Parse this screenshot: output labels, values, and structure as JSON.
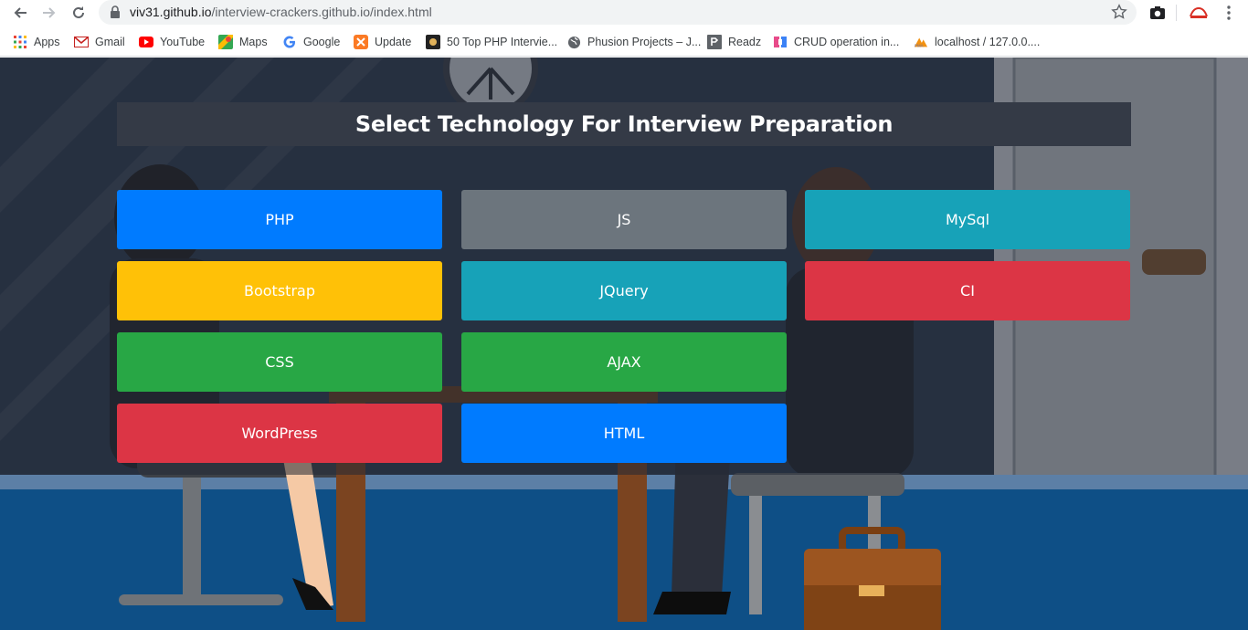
{
  "browser": {
    "url_host": "viv31.github.io",
    "url_path": "/interview-crackers.github.io/index.html",
    "bookmarks": [
      {
        "label": "Apps",
        "icon": "apps-grid-icon"
      },
      {
        "label": "Gmail",
        "icon": "gmail-icon"
      },
      {
        "label": "YouTube",
        "icon": "youtube-icon"
      },
      {
        "label": "Maps",
        "icon": "maps-icon"
      },
      {
        "label": "Google",
        "icon": "google-icon"
      },
      {
        "label": "Update",
        "icon": "xampp-icon"
      },
      {
        "label": "50 Top PHP Intervie...",
        "icon": "site-icon"
      },
      {
        "label": "Phusion Projects – J...",
        "icon": "globe-icon"
      },
      {
        "label": "Readz",
        "icon": "readz-icon"
      },
      {
        "label": "CRUD operation in...",
        "icon": "crud-icon"
      },
      {
        "label": "localhost / 127.0.0....",
        "icon": "phpmyadmin-icon"
      }
    ]
  },
  "page": {
    "title": "Select Technology For Interview Preparation",
    "buttons": [
      {
        "label": "PHP",
        "color": "#007bff"
      },
      {
        "label": "JS",
        "color": "#6c757d"
      },
      {
        "label": "MySql",
        "color": "#17a2b8"
      },
      {
        "label": "Bootstrap",
        "color": "#ffc107"
      },
      {
        "label": "JQuery",
        "color": "#17a2b8"
      },
      {
        "label": "CI",
        "color": "#dc3545"
      },
      {
        "label": "CSS",
        "color": "#28a745"
      },
      {
        "label": "AJAX",
        "color": "#28a745"
      },
      {
        "label": "WordPress",
        "color": "#dc3545"
      },
      {
        "label": "HTML",
        "color": "#007bff"
      }
    ]
  }
}
